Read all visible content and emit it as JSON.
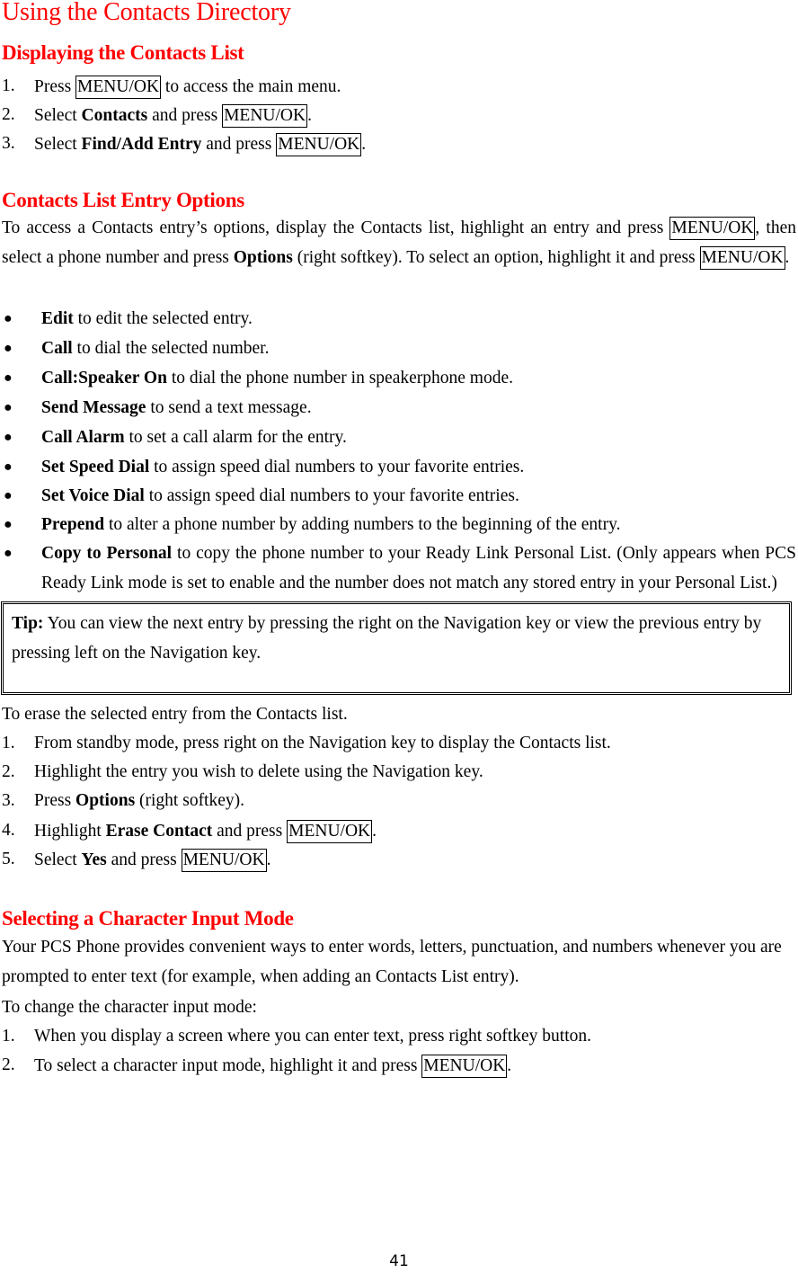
{
  "title": "Using the Contacts Directory",
  "section1": {
    "heading": "Displaying the Contacts List",
    "steps": [
      {
        "num": "1.",
        "pre": "Press ",
        "bold": "",
        "mid": "",
        "key": "MENU/OK",
        "post": " to access the main menu."
      },
      {
        "num": "2.",
        "pre": "Select ",
        "bold": "Contacts",
        "mid": " and press ",
        "key": "MENU/OK",
        "post": "."
      },
      {
        "num": "3.",
        "pre": "Select ",
        "bold": "Find/Add Entry",
        "mid": " and press ",
        "key": "MENU/OK",
        "post": "."
      }
    ]
  },
  "section2": {
    "heading": "Contacts List Entry Options",
    "intro": {
      "p1": "To access a Contacts entry’s options, display the Contacts list, highlight an entry and press ",
      "key1": "MENU/OK",
      "p2": ", then select a phone number and press ",
      "bold1": "Options",
      "p3": " (right softkey). To select an option, highlight it and press ",
      "key2": "MENU/OK",
      "p4": "."
    },
    "options": [
      {
        "bold": "Edit",
        "text": " to edit the selected entry."
      },
      {
        "bold": "Call",
        "text": " to dial the selected number."
      },
      {
        "bold": "Call:Speaker On",
        "text": " to dial the phone number in speakerphone mode."
      },
      {
        "bold": "Send Message",
        "text": " to send a text message."
      },
      {
        "bold": "Call Alarm",
        "text": " to set a call alarm for the entry."
      },
      {
        "bold": "Set Speed Dial",
        "text": " to assign speed dial numbers to your favorite entries."
      },
      {
        "bold": "Set Voice Dial",
        "text": " to assign speed dial numbers to your favorite entries."
      },
      {
        "bold": "Prepend",
        "text": " to alter a phone number by adding numbers to the beginning of the entry."
      },
      {
        "bold": "Copy to Personal",
        "text": " to copy the phone number to your Ready Link Personal List. (Only appears when PCS Ready Link mode is set to enable and the number does not match any stored entry in your Personal List.)"
      }
    ],
    "tip": {
      "label": "Tip:",
      "text": " You can view the next entry by pressing the right on the Navigation key or view the previous entry by pressing left on the Navigation key."
    },
    "erase_intro": "To erase the selected entry from the Contacts list.",
    "erase_steps": [
      {
        "num": "1.",
        "pre": "From standby mode, press right on the Navigation key to display the Contacts list.",
        "bold": "",
        "mid": "",
        "key": "",
        "post": ""
      },
      {
        "num": "2.",
        "pre": "Highlight the entry you wish to delete using the Navigation key.",
        "bold": "",
        "mid": "",
        "key": "",
        "post": ""
      },
      {
        "num": "3.",
        "pre": "Press ",
        "bold": "Options",
        "mid": " (right softkey).",
        "key": "",
        "post": ""
      },
      {
        "num": "4.",
        "pre": "Highlight ",
        "bold": "Erase Contact",
        "mid": " and press ",
        "key": "MENU/OK",
        "post": "."
      },
      {
        "num": "5.",
        "pre": "Select ",
        "bold": "Yes",
        "mid": " and press ",
        "key": "MENU/OK",
        "post": "."
      }
    ]
  },
  "section3": {
    "heading": "Selecting a Character Input Mode",
    "para": "Your PCS Phone provides convenient ways to enter words, letters, punctuation, and numbers whenever you are prompted to enter text (for example, when adding an Contacts List entry).",
    "change_intro": "To change the character input mode:",
    "steps": [
      {
        "num": "1.",
        "pre": "When you display a screen where you can enter text, press right softkey button.",
        "bold": "",
        "mid": "",
        "key": "",
        "post": ""
      },
      {
        "num": "2.",
        "pre": "To select a character input mode, highlight it and press ",
        "bold": "",
        "mid": "",
        "key": "MENU/OK",
        "post": "."
      }
    ]
  },
  "page_number": "41",
  "colors": {
    "heading": "#ff0000",
    "text": "#000000"
  }
}
